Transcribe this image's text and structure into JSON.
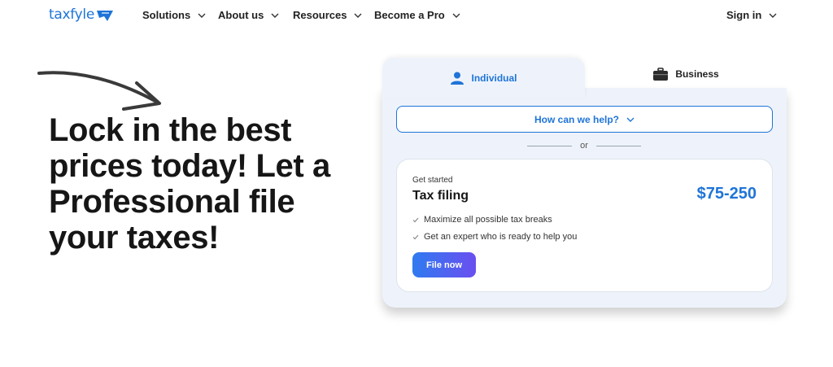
{
  "nav": {
    "logo_text": "taxfyle",
    "items": [
      {
        "label": "Solutions"
      },
      {
        "label": "About us"
      },
      {
        "label": "Resources"
      },
      {
        "label": "Become a Pro"
      }
    ],
    "signin_label": "Sign in"
  },
  "hero": {
    "bold_text": "Lock in the best prices today!",
    "regular_text": " Let a Professional file your taxes!"
  },
  "tabs": {
    "individual": "Individual",
    "business": "Business",
    "active": "Individual"
  },
  "help_select": {
    "label": "How can we help?"
  },
  "divider_text": "or",
  "offer": {
    "eyebrow": "Get started",
    "title": "Tax filing",
    "price": "$75-250",
    "features": [
      "Maximize all possible tax breaks",
      "Get an expert who is ready to help you"
    ],
    "cta_label": "File now"
  },
  "colors": {
    "brand_blue": "#1e74d8",
    "card_bg": "#eef3fb",
    "cta_gradient_start": "#2f7bf0",
    "cta_gradient_end": "#6a4ff0"
  },
  "icons": {
    "logo_mark": "tag-arrow-icon",
    "individual_tab": "person-icon",
    "business_tab": "briefcase-icon",
    "dropdown": "chevron-down-icon",
    "feature_bullet": "check-icon",
    "hero_decoration": "hand-drawn-arrow-icon"
  }
}
